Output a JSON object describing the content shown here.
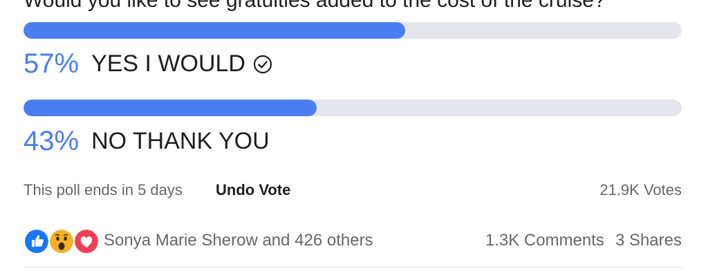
{
  "poll": {
    "question": "Would you like to see gratuities added to the cost of the cruise?",
    "options": [
      {
        "percent_label": "57%",
        "label": "YES I WOULD",
        "fraction": 0.58,
        "selected": true
      },
      {
        "percent_label": "43%",
        "label": "NO THANK YOU",
        "fraction": 0.445,
        "selected": false
      }
    ],
    "ends_text": "This poll ends in 5 days",
    "undo_label": "Undo Vote",
    "votes": "21.9K Votes"
  },
  "social": {
    "reactions": [
      "like-icon",
      "wow-icon",
      "love-icon"
    ],
    "reactors": "Sonya Marie Sherow and 426 others",
    "comments": "1.3K Comments",
    "shares": "3 Shares"
  },
  "colors": {
    "accent": "#4a7ef0",
    "bar_track": "#e4e6eb",
    "like": "#1877f2",
    "wow": "#f7b125",
    "love": "#f33e58"
  }
}
